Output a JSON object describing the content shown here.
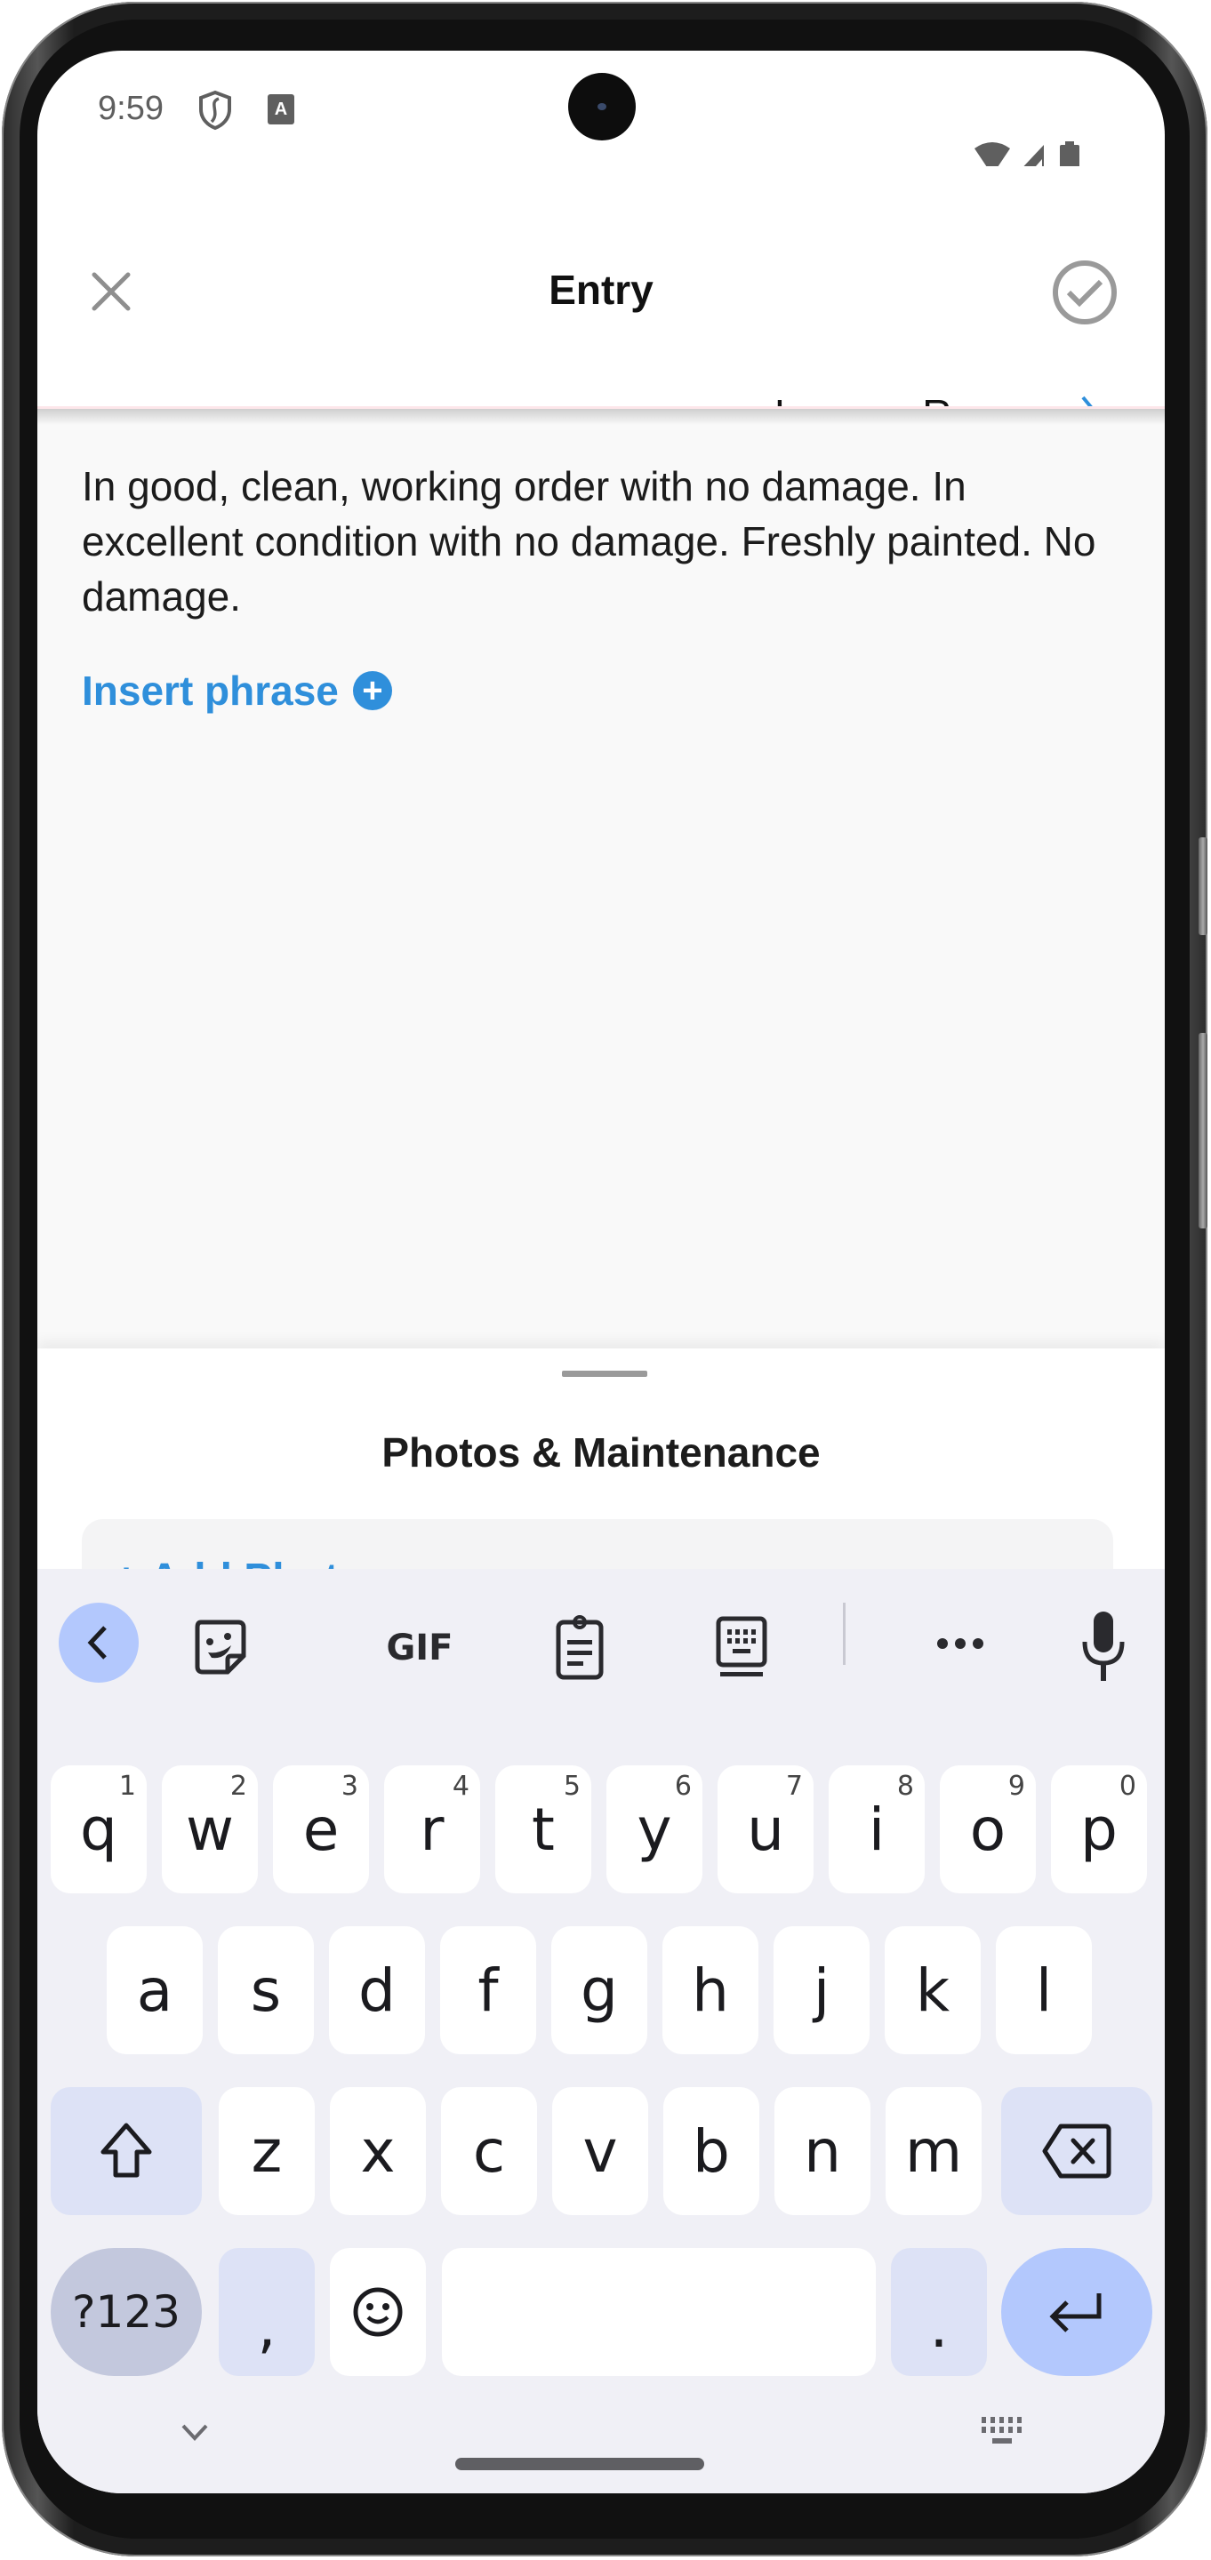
{
  "status_bar": {
    "time": "9:59",
    "left_icons": [
      "shield-icon",
      "accessibility-a-icon"
    ],
    "right_icons": [
      "wifi-icon",
      "signal-icon",
      "battery-icon"
    ]
  },
  "header": {
    "title": "Entry",
    "close_icon": "close-icon",
    "confirm_icon": "check-circle-icon",
    "room_label": "Lounge Room",
    "room_chevron": "chevron-right-icon"
  },
  "entry": {
    "text": "In good, clean, working order with no damage. In excellent condition with no damage. Freshly painted. No damage.",
    "insert_phrase_label": "Insert phrase",
    "insert_phrase_icon": "plus-circle-icon"
  },
  "sheet": {
    "title": "Photos & Maintenance",
    "add_photo_label": "+ Add Photo"
  },
  "keyboard": {
    "toolbar": [
      {
        "name": "back",
        "icon": "chevron-left-icon"
      },
      {
        "name": "sticker",
        "icon": "sticker-icon"
      },
      {
        "name": "gif",
        "label": "GIF"
      },
      {
        "name": "clipboard",
        "icon": "clipboard-icon"
      },
      {
        "name": "keyboard-layout",
        "icon": "keyboard-icon"
      },
      {
        "name": "more",
        "label": "•••"
      },
      {
        "name": "voice",
        "icon": "microphone-icon"
      }
    ],
    "row1": [
      {
        "k": "q",
        "h": "1"
      },
      {
        "k": "w",
        "h": "2"
      },
      {
        "k": "e",
        "h": "3"
      },
      {
        "k": "r",
        "h": "4"
      },
      {
        "k": "t",
        "h": "5"
      },
      {
        "k": "y",
        "h": "6"
      },
      {
        "k": "u",
        "h": "7"
      },
      {
        "k": "i",
        "h": "8"
      },
      {
        "k": "o",
        "h": "9"
      },
      {
        "k": "p",
        "h": "0"
      }
    ],
    "row2": [
      "a",
      "s",
      "d",
      "f",
      "g",
      "h",
      "j",
      "k",
      "l"
    ],
    "row3": [
      "z",
      "x",
      "c",
      "v",
      "b",
      "n",
      "m"
    ],
    "row4": {
      "symbols": "?123",
      "comma": ",",
      "emoji_icon": "emoji-icon",
      "space": "",
      "period": ".",
      "enter_icon": "enter-icon"
    },
    "shift_icon": "shift-icon",
    "backspace_icon": "backspace-icon",
    "nav": {
      "hide_icon": "chevron-down-icon",
      "switch_icon": "keyboard-switch-icon"
    }
  },
  "colors": {
    "accent": "#2f8fdb",
    "key_bg": "#ffffff",
    "mod_key_bg": "#dde2f6",
    "keyboard_bg": "#f0f0f6",
    "enter_bg": "#b3c8fd"
  }
}
